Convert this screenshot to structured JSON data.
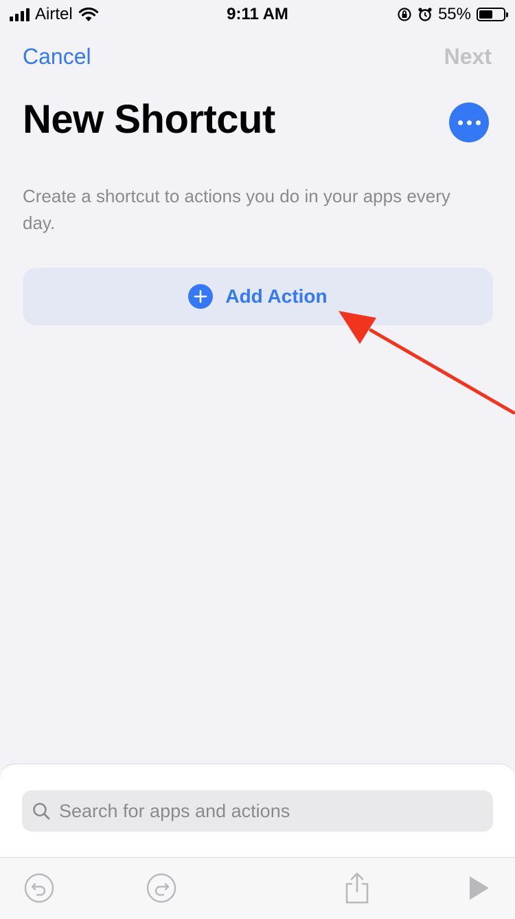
{
  "status_bar": {
    "carrier": "Airtel",
    "time": "9:11 AM",
    "battery_percent": "55%",
    "battery_level": 0.55
  },
  "nav": {
    "cancel_label": "Cancel",
    "next_label": "Next"
  },
  "page": {
    "title": "New Shortcut",
    "subtitle": "Create a shortcut to actions you do in your apps every day."
  },
  "add_action": {
    "label": "Add Action",
    "icon": "plus-circle-icon"
  },
  "search": {
    "placeholder": "Search for apps and actions"
  },
  "toolbar": {
    "icons": [
      "undo-icon",
      "redo-icon",
      "share-icon",
      "play-icon"
    ]
  },
  "colors": {
    "accent": "#3478f6",
    "background": "#f2f2f7",
    "annotation_arrow": "#f0341e",
    "disabled": "#c2c2c6"
  }
}
